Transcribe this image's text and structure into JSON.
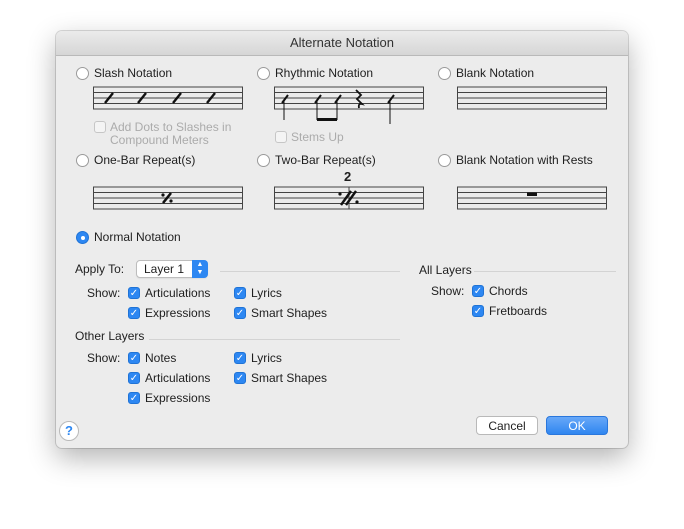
{
  "dialog": {
    "title": "Alternate Notation"
  },
  "options": {
    "slash": {
      "label": "Slash Notation",
      "selected": false
    },
    "rhythmic": {
      "label": "Rhythmic Notation",
      "selected": false
    },
    "blank": {
      "label": "Blank Notation",
      "selected": false
    },
    "one_bar": {
      "label": "One-Bar Repeat(s)",
      "selected": false
    },
    "two_bar": {
      "label": "Two-Bar Repeat(s)",
      "selected": false
    },
    "two_bar_number": "2",
    "blank_rests": {
      "label": "Blank Notation with Rests",
      "selected": false
    },
    "normal": {
      "label": "Normal Notation",
      "selected": true
    },
    "add_dots": {
      "label_line1": "Add Dots to Slashes in",
      "label_line2": "Compound Meters",
      "checked": false,
      "enabled": false
    },
    "stems_up": {
      "label": "Stems Up",
      "checked": false,
      "enabled": false
    }
  },
  "apply_to": {
    "label": "Apply To:",
    "value": "Layer 1"
  },
  "show_label": "Show:",
  "layer_show": {
    "articulations": {
      "label": "Articulations",
      "checked": true
    },
    "lyrics": {
      "label": "Lyrics",
      "checked": true
    },
    "expressions": {
      "label": "Expressions",
      "checked": true
    },
    "smart_shapes": {
      "label": "Smart Shapes",
      "checked": true
    }
  },
  "all_layers": {
    "title": "All Layers",
    "chords": {
      "label": "Chords",
      "checked": true
    },
    "fretboards": {
      "label": "Fretboards",
      "checked": true
    }
  },
  "other_layers": {
    "title": "Other Layers",
    "notes": {
      "label": "Notes",
      "checked": true
    },
    "lyrics": {
      "label": "Lyrics",
      "checked": true
    },
    "articulations": {
      "label": "Articulations",
      "checked": true
    },
    "smart_shapes": {
      "label": "Smart Shapes",
      "checked": true
    },
    "expressions": {
      "label": "Expressions",
      "checked": true
    }
  },
  "buttons": {
    "cancel": "Cancel",
    "ok": "OK",
    "help": "?"
  },
  "colors": {
    "accent": "#2d87f2",
    "dialog_bg": "#ececec"
  }
}
